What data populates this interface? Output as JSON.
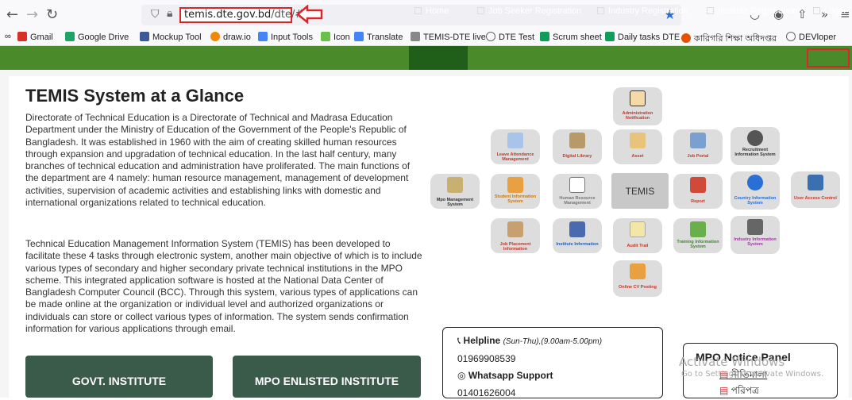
{
  "browser": {
    "url_host": "temis.dte.gov.bd",
    "url_path": "/dte/#/"
  },
  "bookmarks": [
    {
      "label": "Gmail",
      "color": "#d93025"
    },
    {
      "label": "Google Drive",
      "color": "#1fa463"
    },
    {
      "label": "Mockup Tool",
      "color": "#3b5998"
    },
    {
      "label": "draw.io",
      "color": "#f08705"
    },
    {
      "label": "Input Tools",
      "color": "#4285f4"
    },
    {
      "label": "Icon",
      "color": "#6bc04b"
    },
    {
      "label": "Translate",
      "color": "#4285f4"
    },
    {
      "label": "TEMIS-DTE live",
      "color": "#666"
    },
    {
      "label": "DTE Test",
      "color": "#666"
    },
    {
      "label": "Scrum sheet",
      "color": "#0f9d58"
    },
    {
      "label": "Daily tasks DTE",
      "color": "#0f9d58"
    },
    {
      "label": "কারিগরি শিক্ষা অধিদপ্তর",
      "color": "#e65100"
    },
    {
      "label": "DEVloper",
      "color": "#666"
    }
  ],
  "nav": {
    "home": "Home",
    "job_seeker": "Job Seeker Registration",
    "industry": "Industry Registration",
    "institute": "Institute Registration",
    "login": "Login"
  },
  "main": {
    "title": "TEMIS System at a Glance",
    "para1": "Directorate of Technical Education is a Directorate of Technical and Madrasa Education Department under the Ministry of Education of the Government of the People's Republic of Bangladesh. It was established in 1960 with the aim of creating skilled human resources through expansion and upgradation of technical education. In the last half century, many branches of technical education and administration have proliferated. The main functions of the department are 4 namely: human resource management, management of development activities, supervision of academic activities and establishing links with domestic and international organizations related to technical education.",
    "para2": "Technical Education Management Information System (TEMIS) has been developed to facilitate these 4 tasks through electronic system, another main objective of which is to include various types of secondary and higher secondary private technical institutions in the MPO scheme. This integrated application software is hosted at the National Data Center of Bangladesh Computer Council (BCC). Through this system, various types of applications can be made online at the organization or individual level and authorized organizations or individuals can store or collect various types of information. The system sends confirmation information for various applications through email.",
    "card1": "GOVT. INSTITUTE",
    "card2": "MPO ENLISTED INSTITUTE"
  },
  "modules": {
    "center": "TEMIS",
    "admin": "Administration Notification",
    "leave": "Leave Attendance Management",
    "library": "Digital Library",
    "asset": "Asset",
    "jobportal": "Job Portal",
    "recruit": "Recruitment Information System",
    "mpo": "Mpo Management System",
    "student": "Student Information System",
    "hrm": "Human Resource Management",
    "report": "Report",
    "country": "Country Information System",
    "uac": "User Access Control",
    "placement": "Job Placement Information",
    "institute": "Institute Information",
    "audit": "Audit Trail",
    "training": "Training Information System",
    "industry": "Industry Information System",
    "cv": "Online CV Posting"
  },
  "helpline": {
    "title": "Helpline",
    "hours": "(Sun-Thu),(9.00am-5.00pm)",
    "phone": "01969908539",
    "whatsapp_label": "Whatsapp Support",
    "whatsapp_phone": "01401626004"
  },
  "mpo_panel": {
    "title": "MPO Notice Panel",
    "item1": "নীতিমালা",
    "item2": "পরিপত্র"
  },
  "watermark": {
    "line1": "Activate Windows",
    "line2": "Go to Settings to activate Windows."
  }
}
